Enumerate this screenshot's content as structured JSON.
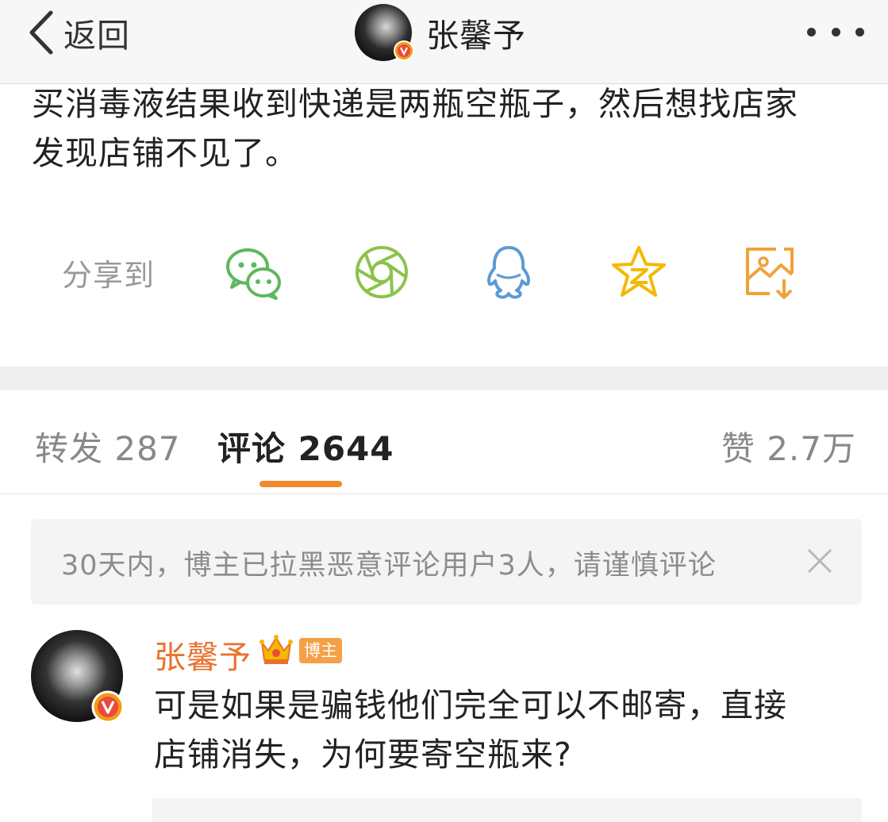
{
  "nav": {
    "back_label": "返回",
    "title": "张馨予"
  },
  "post": {
    "text": "买消毒液结果收到快递是两瓶空瓶子，然后想找店家\n发现店铺不见了。"
  },
  "share": {
    "label": "分享到",
    "targets": [
      {
        "name": "wechat",
        "color": "#5cb85c"
      },
      {
        "name": "moments",
        "color": "#8bc34a"
      },
      {
        "name": "qq",
        "color": "#5b9bd5"
      },
      {
        "name": "qzone",
        "color": "#f5b800"
      },
      {
        "name": "save-image",
        "color": "#f0a23a"
      }
    ]
  },
  "tabs": {
    "repost": "转发 287",
    "comments": "评论 2644",
    "likes": "赞 2.7万",
    "accent_color": "#f08a2c"
  },
  "notice": {
    "text": "30天内，博主已拉黑恶意评论用户3人，请谨慎评论"
  },
  "comment": {
    "author": "张馨予",
    "author_color": "#e8722d",
    "badge": "博主",
    "text": "可是如果是骗钱他们完全可以不邮寄，直接\n店铺消失，为何要寄空瓶来?"
  }
}
